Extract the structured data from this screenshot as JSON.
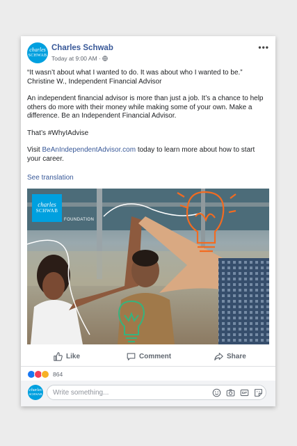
{
  "post": {
    "page_name": "Charles Schwab",
    "timestamp": "Today at 9:00 AM",
    "meta_sep": "·",
    "avatar_line1": "charles",
    "avatar_line2": "SCHWAB",
    "more": "•••",
    "quote": "“It wasn’t about what I wanted to do. It was about who I wanted to be.”",
    "attribution": "Christine W., Independent Financial Advisor",
    "paragraph": "An independent financial advisor is more than just a job. It’s a chance to help others do more with their money while making some of your own. Make a difference. Be an Independent Financial Advisor.",
    "hashtag_line": "That’s #WhyIAdvise",
    "cta_prefix": "Visit ",
    "cta_link": "BeAnIndependentAdvisor.com",
    "cta_suffix": " today to learn more about how to start your career.",
    "see_translation": "See translation"
  },
  "photo": {
    "logo_line1": "charles",
    "logo_line2": "SCHWAB",
    "logo_sub": "FOUNDATION"
  },
  "actions": {
    "like": "Like",
    "comment": "Comment",
    "share": "Share"
  },
  "reactions": {
    "count": "864",
    "colors": [
      "#1877f2",
      "#f33e58",
      "#f7b125"
    ]
  },
  "composer": {
    "placeholder": "Write something..."
  }
}
